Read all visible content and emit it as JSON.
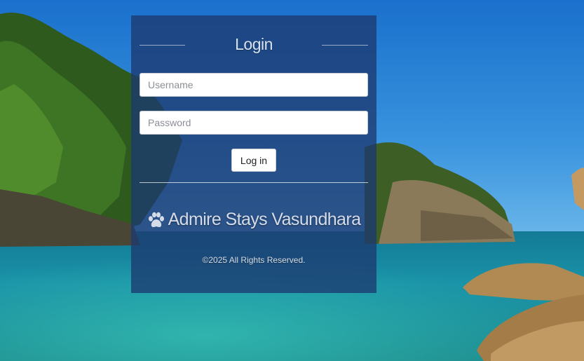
{
  "login": {
    "title": "Login",
    "username_placeholder": "Username",
    "password_placeholder": "Password",
    "submit_label": "Log in"
  },
  "brand": {
    "icon": "paw-icon",
    "name": "Admire Stays Vasundhara"
  },
  "footer": {
    "copyright": "©2025 All Rights Reserved."
  },
  "colors": {
    "panel": "#1c3a70",
    "sky": "#2a86d8",
    "sea": "#1b8fa6"
  }
}
